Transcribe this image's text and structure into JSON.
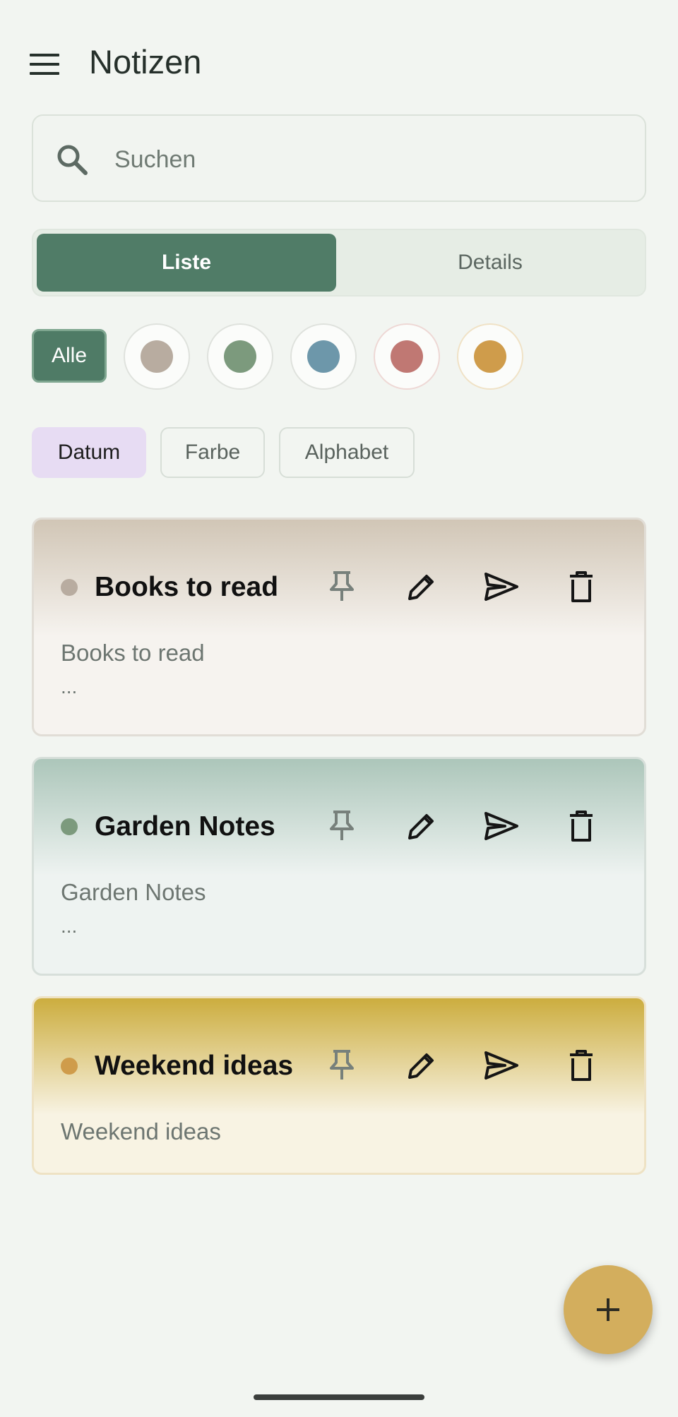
{
  "app": {
    "title": "Notizen"
  },
  "search": {
    "placeholder": "Suchen"
  },
  "view_toggle": {
    "list_label": "Liste",
    "details_label": "Details",
    "selected": "Liste"
  },
  "color_filter": {
    "all_label": "Alle",
    "selected": "Alle",
    "colors": [
      {
        "name": "taupe",
        "hex": "#b8aca0",
        "ring": "#dfe2dd"
      },
      {
        "name": "sage",
        "hex": "#7c9a7d",
        "ring": "#dfe2dd"
      },
      {
        "name": "blue",
        "hex": "#6d97aa",
        "ring": "#dfe2dd"
      },
      {
        "name": "rose",
        "hex": "#c07873",
        "ring": "#eed8d5"
      },
      {
        "name": "mustard",
        "hex": "#cf9c4b",
        "ring": "#f0e2c6"
      }
    ]
  },
  "sort": {
    "options": [
      "Datum",
      "Farbe",
      "Alphabet"
    ],
    "selected": "Datum"
  },
  "notes": [
    {
      "title": "Books to read",
      "preview": "Books to read",
      "ellipsis": "...",
      "color": "#b8aca0",
      "header_color": "#d1c6b6",
      "body_color": "#f6f3ef",
      "border_color": "#e1ddd6"
    },
    {
      "title": "Garden Notes",
      "preview": "Garden Notes",
      "ellipsis": "...",
      "color": "#7c9a7d",
      "header_color": "#acc6ba",
      "body_color": "#eef3f1",
      "border_color": "#d7dfda"
    },
    {
      "title": "Weekend ideas",
      "preview": "Weekend ideas",
      "color": "#cf9c4b",
      "header_color": "#ccad3e",
      "body_color": "#f8f3e3",
      "border_color": "#eee2c4"
    }
  ],
  "actions": {
    "pin": "pin-icon",
    "edit": "pencil-icon",
    "share": "send-icon",
    "delete": "trash-icon"
  },
  "fab": {
    "icon": "plus-icon",
    "color": "#d3ae5d"
  }
}
